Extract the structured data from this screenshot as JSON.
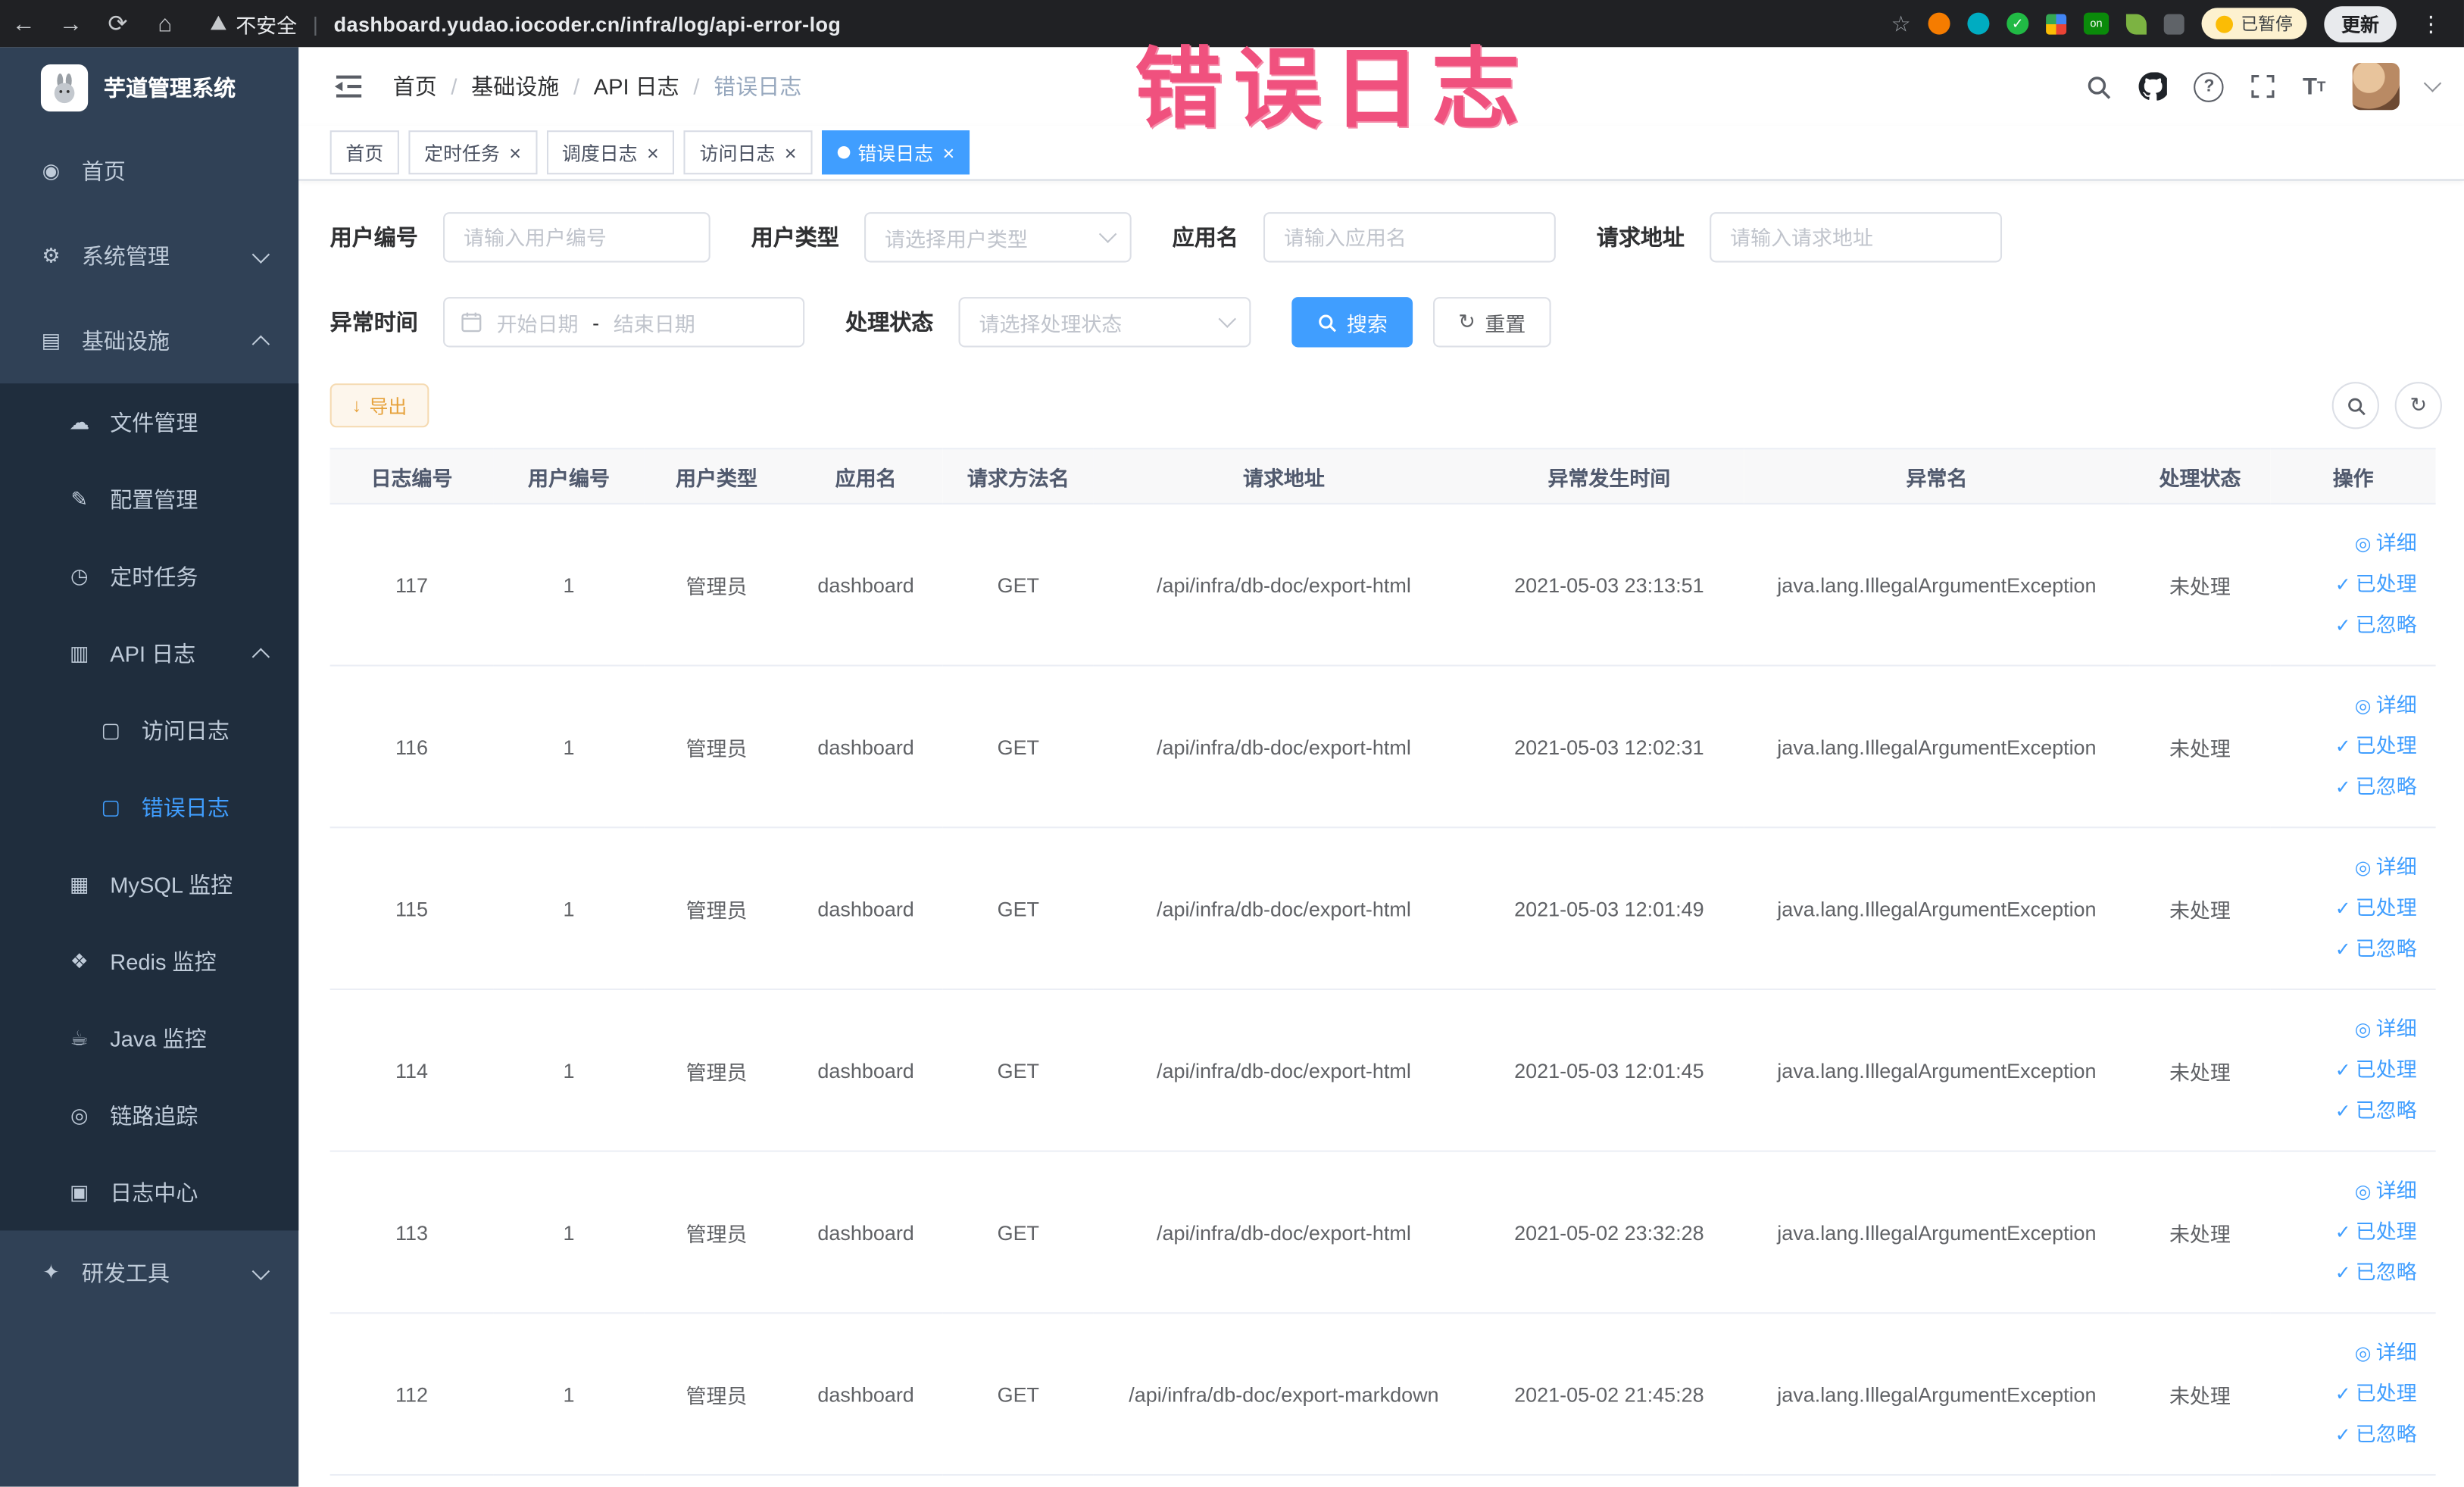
{
  "browser": {
    "security_label": "不安全",
    "url": "dashboard.yudao.iocoder.cn/infra/log/api-error-log",
    "paused_badge": "已暂停",
    "update_label": "更新"
  },
  "overlay_title": "错误日志",
  "sidebar": {
    "logo_title": "芋道管理系统",
    "items": [
      {
        "label": "首页",
        "icon": "◉"
      },
      {
        "label": "系统管理",
        "icon": "⚙"
      },
      {
        "label": "基础设施",
        "icon": "▤",
        "children": [
          {
            "label": "文件管理",
            "icon": "☁"
          },
          {
            "label": "配置管理",
            "icon": "✎"
          },
          {
            "label": "定时任务",
            "icon": "◷"
          },
          {
            "label": "API 日志",
            "icon": "▥",
            "children": [
              {
                "label": "访问日志",
                "icon": "▢"
              },
              {
                "label": "错误日志",
                "icon": "▢"
              }
            ]
          },
          {
            "label": "MySQL 监控",
            "icon": "▦"
          },
          {
            "label": "Redis 监控",
            "icon": "❖"
          },
          {
            "label": "Java 监控",
            "icon": "☕"
          },
          {
            "label": "链路追踪",
            "icon": "◎"
          },
          {
            "label": "日志中心",
            "icon": "▣"
          }
        ]
      },
      {
        "label": "研发工具",
        "icon": "✦"
      }
    ]
  },
  "header": {
    "breadcrumb": [
      "首页",
      "基础设施",
      "API 日志",
      "错误日志"
    ]
  },
  "tabs": [
    {
      "label": "首页"
    },
    {
      "label": "定时任务"
    },
    {
      "label": "调度日志"
    },
    {
      "label": "访问日志"
    },
    {
      "label": "错误日志"
    }
  ],
  "filters": {
    "user_id": {
      "label": "用户编号",
      "placeholder": "请输入用户编号"
    },
    "user_type": {
      "label": "用户类型",
      "placeholder": "请选择用户类型"
    },
    "app_name": {
      "label": "应用名",
      "placeholder": "请输入应用名"
    },
    "request_url": {
      "label": "请求地址",
      "placeholder": "请输入请求地址"
    },
    "exception_time": {
      "label": "异常时间",
      "start_placeholder": "开始日期",
      "separator": "-",
      "end_placeholder": "结束日期"
    },
    "process_status": {
      "label": "处理状态",
      "placeholder": "请选择处理状态"
    },
    "search_label": "搜索",
    "reset_label": "重置"
  },
  "toolbar": {
    "export_label": "导出"
  },
  "table": {
    "columns": [
      "日志编号",
      "用户编号",
      "用户类型",
      "应用名",
      "请求方法名",
      "请求地址",
      "异常发生时间",
      "异常名",
      "处理状态",
      "操作"
    ],
    "action_labels": {
      "detail": "详细",
      "processed": "已处理",
      "ignored": "已忽略"
    },
    "rows": [
      {
        "id": "117",
        "user_id": "1",
        "user_type": "管理员",
        "app": "dashboard",
        "method": "GET",
        "url": "/api/infra/db-doc/export-html",
        "time": "2021-05-03 23:13:51",
        "exception": "java.lang.IllegalArgumentException",
        "status": "未处理"
      },
      {
        "id": "116",
        "user_id": "1",
        "user_type": "管理员",
        "app": "dashboard",
        "method": "GET",
        "url": "/api/infra/db-doc/export-html",
        "time": "2021-05-03 12:02:31",
        "exception": "java.lang.IllegalArgumentException",
        "status": "未处理"
      },
      {
        "id": "115",
        "user_id": "1",
        "user_type": "管理员",
        "app": "dashboard",
        "method": "GET",
        "url": "/api/infra/db-doc/export-html",
        "time": "2021-05-03 12:01:49",
        "exception": "java.lang.IllegalArgumentException",
        "status": "未处理"
      },
      {
        "id": "114",
        "user_id": "1",
        "user_type": "管理员",
        "app": "dashboard",
        "method": "GET",
        "url": "/api/infra/db-doc/export-html",
        "time": "2021-05-03 12:01:45",
        "exception": "java.lang.IllegalArgumentException",
        "status": "未处理"
      },
      {
        "id": "113",
        "user_id": "1",
        "user_type": "管理员",
        "app": "dashboard",
        "method": "GET",
        "url": "/api/infra/db-doc/export-html",
        "time": "2021-05-02 23:32:28",
        "exception": "java.lang.IllegalArgumentException",
        "status": "未处理"
      },
      {
        "id": "112",
        "user_id": "1",
        "user_type": "管理员",
        "app": "dashboard",
        "method": "GET",
        "url": "/api/infra/db-doc/export-markdown",
        "time": "2021-05-02 21:45:28",
        "exception": "java.lang.IllegalArgumentException",
        "status": "未处理"
      }
    ]
  },
  "colors": {
    "accent": "#409eff",
    "sidebar_bg": "#304156",
    "submenu_bg": "#1f2d3d",
    "warning": "#e6a23c",
    "overlay_pink": "#f0517e",
    "chrome_bg": "#202124"
  }
}
